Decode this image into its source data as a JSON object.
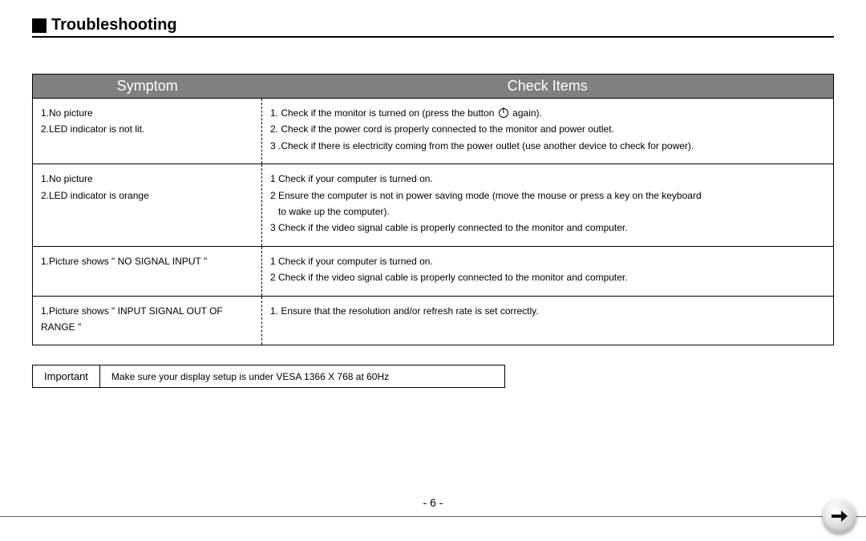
{
  "title": "Troubleshooting",
  "columns": {
    "symptom": "Symptom",
    "check": "Check Items"
  },
  "rows": [
    {
      "symptom": [
        "1.No picture",
        "2.LED indicator is not lit."
      ],
      "check_pre": "1. Check if the monitor is turned on (press the button ",
      "check_post": " again).",
      "check_rest": [
        "2. Check if the power cord is properly connected to the monitor and power outlet.",
        "3 .Check if there is electricity coming from the power outlet (use another device to check for power)."
      ]
    },
    {
      "symptom": [
        "1.No picture",
        "2.LED indicator is orange"
      ],
      "check": [
        "1 Check if your computer is turned on.",
        "2 Ensure the computer is not in power saving mode (move the mouse or press a key on the keyboard",
        "   to wake up the computer).",
        "3 Check if the video signal cable is properly connected to the monitor and computer."
      ]
    },
    {
      "symptom": [
        "1.Picture shows \" NO SIGNAL INPUT \""
      ],
      "check": [
        "1 Check if your computer is turned on.",
        "2 Check if the video signal cable is properly connected to the monitor and computer."
      ]
    },
    {
      "symptom": [
        "1.Picture shows \" INPUT SIGNAL OUT OF RANGE \""
      ],
      "check": [
        "1. Ensure that the resolution and/or refresh rate is set correctly."
      ]
    }
  ],
  "important": {
    "label": "Important",
    "text": "Make sure your display setup is under VESA 1366 X 768 at 60Hz"
  },
  "page_number": "- 6 -",
  "icons": {
    "power": "power-icon",
    "next": "next-arrow-icon"
  }
}
